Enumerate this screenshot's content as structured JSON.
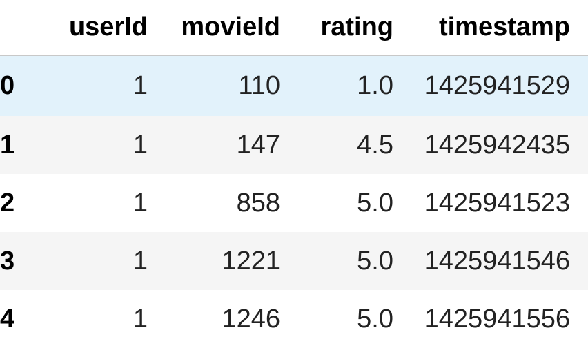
{
  "table": {
    "columns": [
      "",
      "userId",
      "movieId",
      "rating",
      "timestamp"
    ],
    "rows": [
      {
        "index": "0",
        "userId": "1",
        "movieId": "110",
        "rating": "1.0",
        "timestamp": "1425941529"
      },
      {
        "index": "1",
        "userId": "1",
        "movieId": "147",
        "rating": "4.5",
        "timestamp": "1425942435"
      },
      {
        "index": "2",
        "userId": "1",
        "movieId": "858",
        "rating": "5.0",
        "timestamp": "1425941523"
      },
      {
        "index": "3",
        "userId": "1",
        "movieId": "1221",
        "rating": "5.0",
        "timestamp": "1425941546"
      },
      {
        "index": "4",
        "userId": "1",
        "movieId": "1246",
        "rating": "5.0",
        "timestamp": "1425941556"
      }
    ]
  },
  "colors": {
    "hover_row": "#e2f2fb",
    "striped_row": "#f5f5f5",
    "header_border": "#c8c8c8"
  }
}
